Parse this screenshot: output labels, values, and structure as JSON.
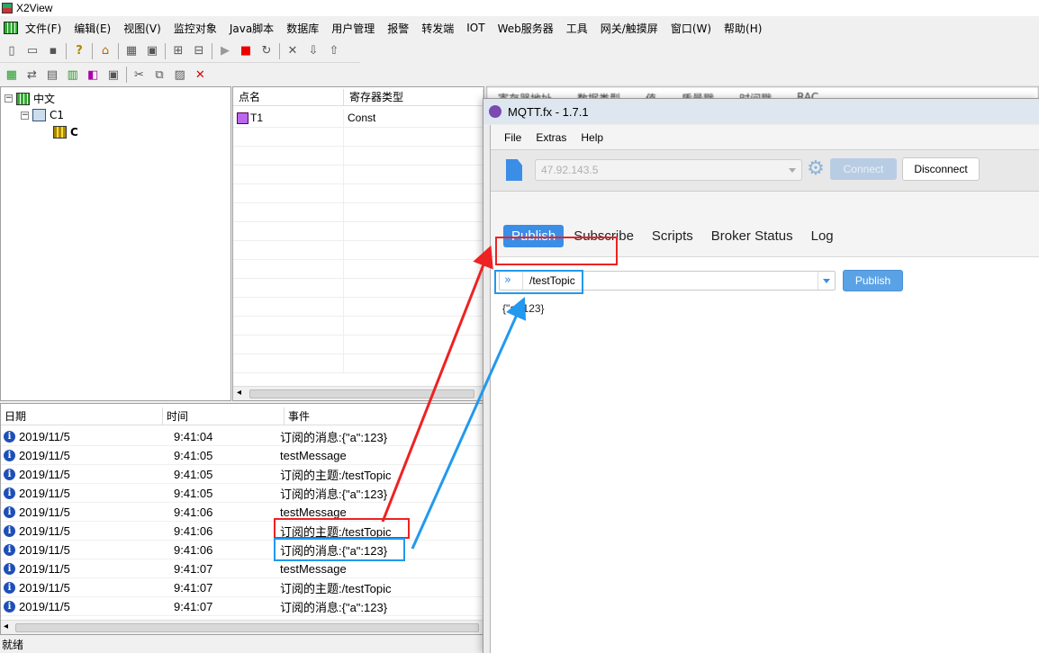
{
  "x2view": {
    "title": "X2View",
    "menu": [
      "文件(F)",
      "编辑(E)",
      "视图(V)",
      "监控对象",
      "Java脚本",
      "数据库",
      "用户管理",
      "报警",
      "转发端",
      "IOT",
      "Web服务器",
      "工具",
      "网关/触摸屏",
      "窗口(W)",
      "帮助(H)"
    ],
    "tree": {
      "root": "中文",
      "child": "C1",
      "leaf": "C"
    },
    "grid": {
      "columns": [
        "点名",
        "寄存器类型"
      ],
      "rows": [
        {
          "name": "T1",
          "type": "Const"
        }
      ]
    },
    "background_columns": [
      "寄存器地址",
      "数据类型",
      "值",
      "质量戳",
      "时间戳",
      "RAC..."
    ],
    "log": {
      "columns": [
        "日期",
        "时间",
        "事件"
      ],
      "rows": [
        {
          "date": "2019/11/5",
          "time": "9:41:04",
          "event": "订阅的消息:{\"a\":123}"
        },
        {
          "date": "2019/11/5",
          "time": "9:41:05",
          "event": "testMessage"
        },
        {
          "date": "2019/11/5",
          "time": "9:41:05",
          "event": "订阅的主题:/testTopic"
        },
        {
          "date": "2019/11/5",
          "time": "9:41:05",
          "event": "订阅的消息:{\"a\":123}"
        },
        {
          "date": "2019/11/5",
          "time": "9:41:06",
          "event": "testMessage"
        },
        {
          "date": "2019/11/5",
          "time": "9:41:06",
          "event": "订阅的主题:/testTopic"
        },
        {
          "date": "2019/11/5",
          "time": "9:41:06",
          "event": "订阅的消息:{\"a\":123}"
        },
        {
          "date": "2019/11/5",
          "time": "9:41:07",
          "event": "testMessage"
        },
        {
          "date": "2019/11/5",
          "time": "9:41:07",
          "event": "订阅的主题:/testTopic"
        },
        {
          "date": "2019/11/5",
          "time": "9:41:07",
          "event": "订阅的消息:{\"a\":123}"
        }
      ]
    },
    "status": "就绪"
  },
  "mqtt": {
    "title": "MQTT.fx - 1.7.1",
    "menu": [
      "File",
      "Extras",
      "Help"
    ],
    "broker": "47.92.143.5",
    "connect_label": "Connect",
    "disconnect_label": "Disconnect",
    "tabs": [
      "Publish",
      "Subscribe",
      "Scripts",
      "Broker Status",
      "Log"
    ],
    "active_tab": "Publish",
    "topic": "/testTopic",
    "publish_label": "Publish",
    "payload": "{\"a\":123}"
  },
  "colors": {
    "accent": "#3a8ee6",
    "highlight_red": "#ee2222",
    "highlight_blue": "#2299ee"
  }
}
